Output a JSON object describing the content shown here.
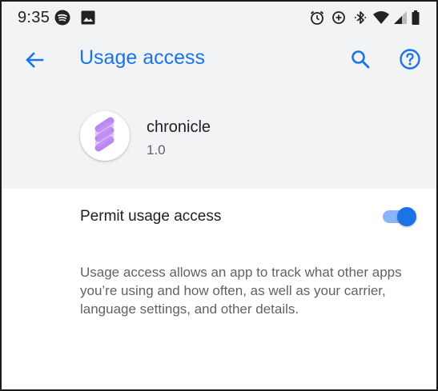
{
  "status_bar": {
    "time": "9:35",
    "left_icons": [
      "spotify-icon",
      "image-icon"
    ],
    "right_icons": [
      "alarm-icon",
      "data-saver-icon",
      "bluetooth-icon",
      "wifi-icon",
      "signal-icon",
      "battery-icon"
    ]
  },
  "app_bar": {
    "title": "Usage access",
    "back_icon": "arrow-back-icon",
    "search_icon": "search-icon",
    "help_icon": "help-icon"
  },
  "app_header": {
    "name": "chronicle",
    "version": "1.0"
  },
  "permit": {
    "label": "Permit usage access",
    "enabled": true
  },
  "description": "Usage access allows an app to track what other apps you’re using and how often, as well as your carrier, language settings, and other details.",
  "colors": {
    "accent": "#1a73e8",
    "toggle_track": "#8ab4f8",
    "header_background": "#f1f3f5",
    "app_icon_purple": "#b47cf0"
  }
}
